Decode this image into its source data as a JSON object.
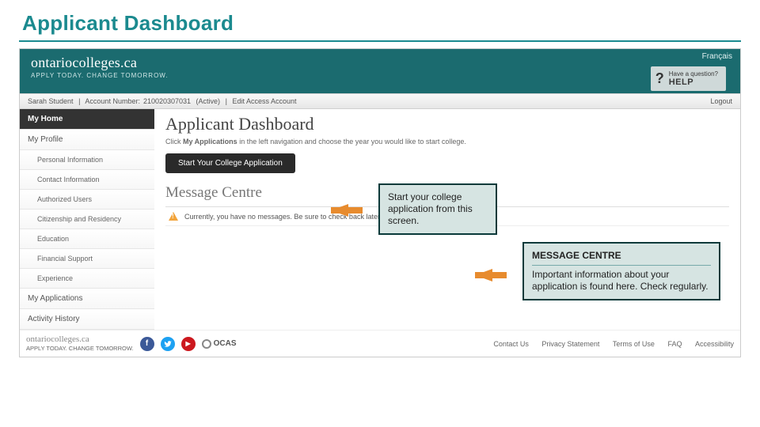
{
  "slide": {
    "title": "Applicant Dashboard"
  },
  "header": {
    "lang_link": "Français",
    "brand": "ontariocolleges.ca",
    "tagline": "APPLY TODAY. CHANGE TOMORROW.",
    "help": {
      "question": "Have a question?",
      "label": "HELP"
    }
  },
  "account_bar": {
    "user": "Sarah Student",
    "account_label": "Account Number:",
    "account_number": "210020307031",
    "status": "(Active)",
    "edit_link": "Edit Access Account",
    "logout": "Logout"
  },
  "sidebar": {
    "items": [
      {
        "label": "My Home",
        "active": true
      },
      {
        "label": "My Profile"
      },
      {
        "label": "Personal Information",
        "sub": true
      },
      {
        "label": "Contact Information",
        "sub": true
      },
      {
        "label": "Authorized Users",
        "sub": true
      },
      {
        "label": "Citizenship and Residency",
        "sub": true
      },
      {
        "label": "Education",
        "sub": true
      },
      {
        "label": "Financial Support",
        "sub": true
      },
      {
        "label": "Experience",
        "sub": true
      },
      {
        "label": "My Applications"
      },
      {
        "label": "Activity History"
      }
    ]
  },
  "main": {
    "heading": "Applicant Dashboard",
    "lead_prefix": "Click ",
    "lead_bold": "My Applications",
    "lead_suffix": " in the left navigation and choose the year you would like to start college.",
    "start_button": "Start Your College Application",
    "msg_heading": "Message Centre",
    "msg_text": "Currently, you have no messages. Be sure to check back later."
  },
  "callouts": {
    "start": "Start your college application from this screen.",
    "msg_title": "MESSAGE CENTRE",
    "msg_body": "Important information about your application is found here. Check regularly."
  },
  "footer": {
    "brand": "ontariocolleges.ca",
    "brand_tag": "APPLY TODAY. CHANGE TOMORROW.",
    "ocas": "OCAS",
    "links": [
      "Contact Us",
      "Privacy Statement",
      "Terms of Use",
      "FAQ",
      "Accessibility"
    ]
  }
}
